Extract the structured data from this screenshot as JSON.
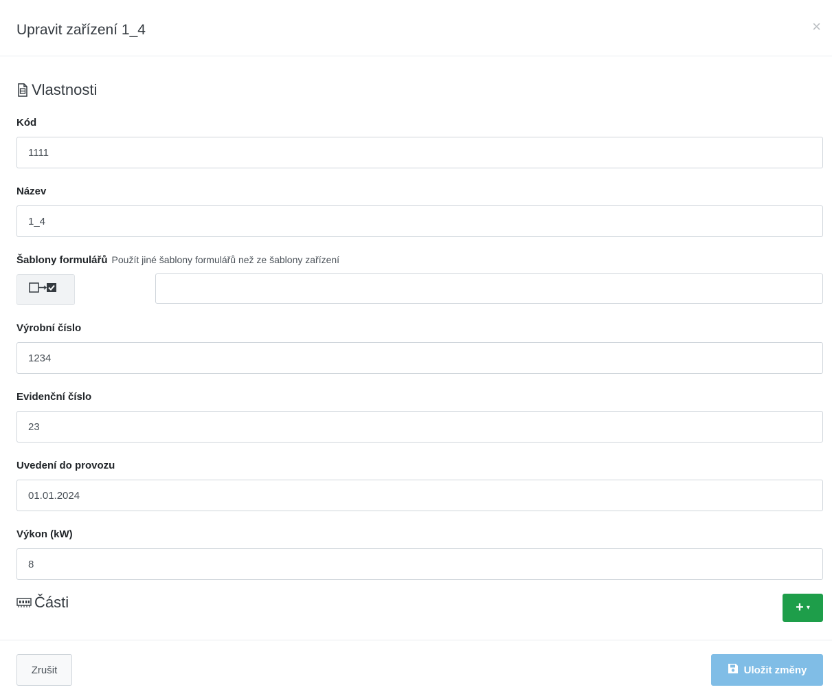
{
  "modal": {
    "title": "Upravit zařízení 1_4",
    "close_glyph": "×"
  },
  "properties": {
    "title": "Vlastnosti",
    "icon": "document-icon"
  },
  "fields": {
    "code": {
      "label": "Kód",
      "value": "1111"
    },
    "name": {
      "label": "Název",
      "value": "1_4"
    },
    "templates": {
      "label": "Šablony formulářů",
      "hint": "Použít jiné šablony formulářů než ze šablony zařízení",
      "value": ""
    },
    "serial": {
      "label": "Výrobní číslo",
      "value": "1234"
    },
    "registry": {
      "label": "Evidenční číslo",
      "value": "23"
    },
    "commissioning": {
      "label": "Uvedení do provozu",
      "value": "01.01.2024"
    },
    "power": {
      "label": "Výkon (kW)",
      "value": "8"
    }
  },
  "parts": {
    "title": "Části",
    "icon": "memory-icon",
    "add_label": "+",
    "add_caret": "▾"
  },
  "footer": {
    "cancel_label": "Zrušit",
    "save_label": "Uložit změny"
  },
  "colors": {
    "add_button": "#1e9e4a",
    "save_button": "#80bde6"
  }
}
